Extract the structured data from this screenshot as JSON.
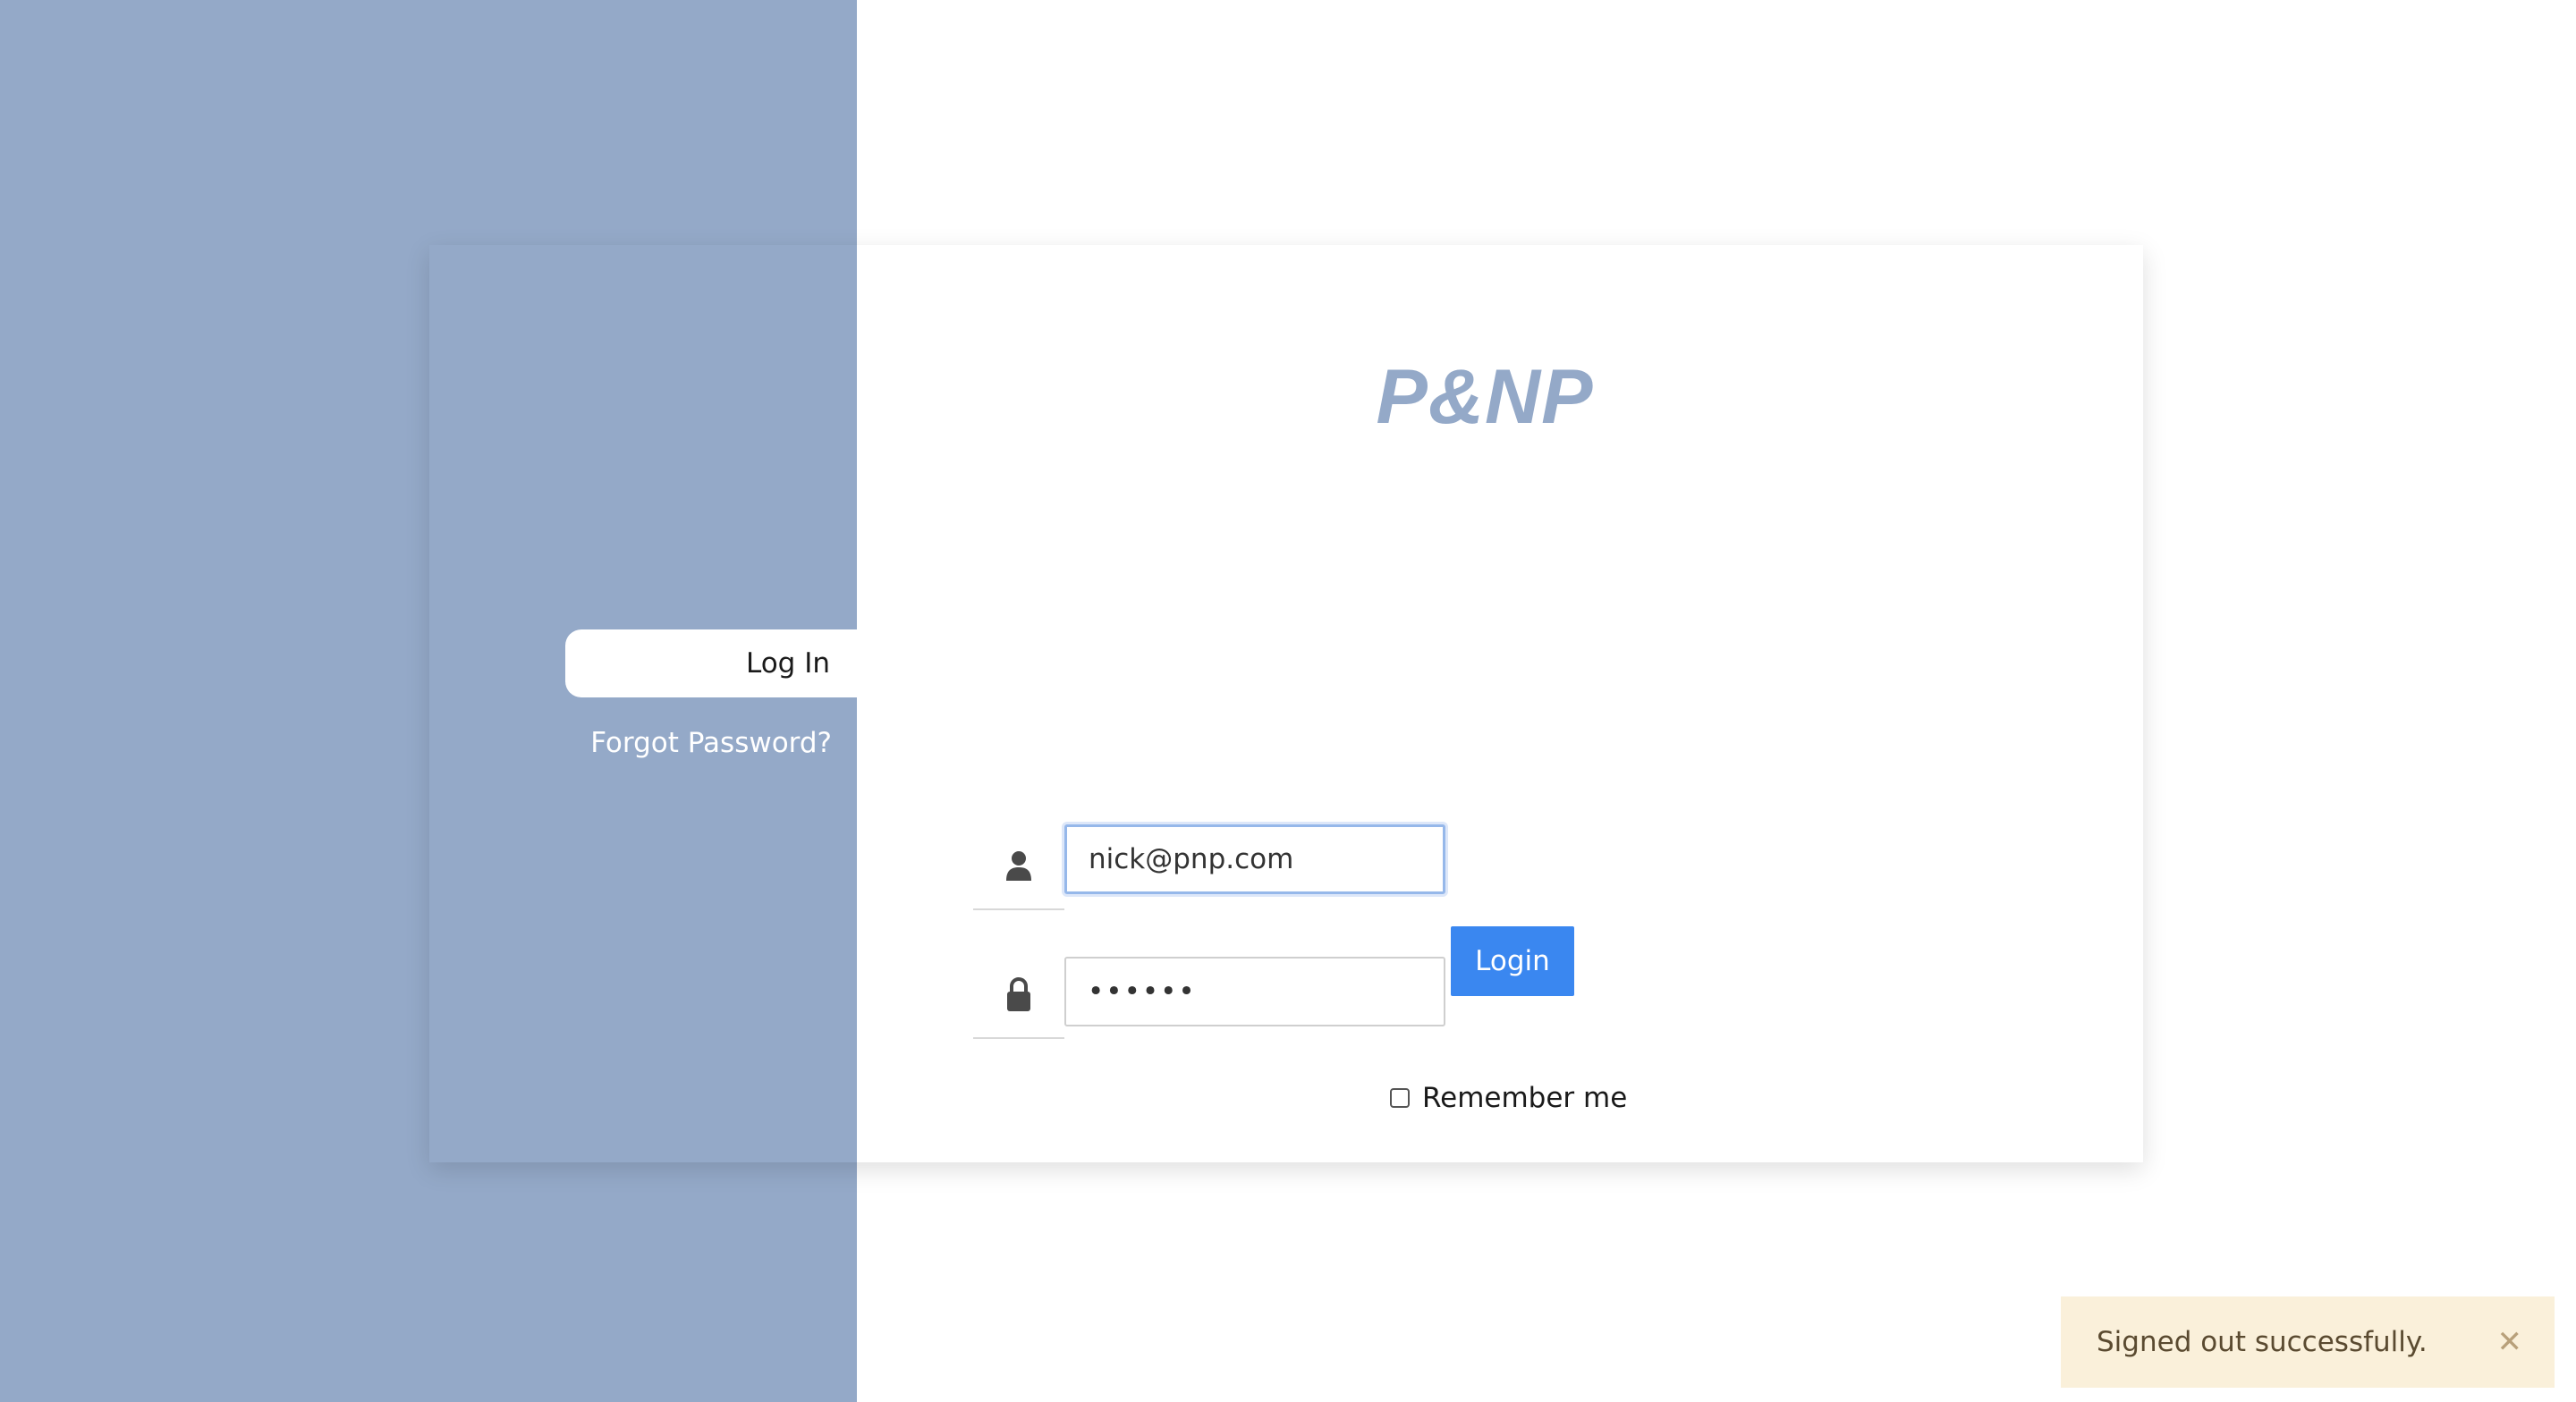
{
  "sidebar": {
    "login_label": "Log In",
    "forgot_label": "Forgot Password?"
  },
  "brand": {
    "logo_text": "P&NP",
    "color": "#94a9c8"
  },
  "form": {
    "email": {
      "value": "nick@pnp.com",
      "icon": "user-icon"
    },
    "password": {
      "value": "••••••",
      "icon": "lock-icon"
    },
    "remember_label": "Remember me",
    "remember_checked": false,
    "submit_label": "Login"
  },
  "toast": {
    "message": "Signed out successfully.",
    "close_icon": "close-icon",
    "close_glyph": "✕"
  },
  "colors": {
    "accent": "#3a87f0",
    "panel": "#94a9c8",
    "toast_bg": "#faf0da"
  }
}
